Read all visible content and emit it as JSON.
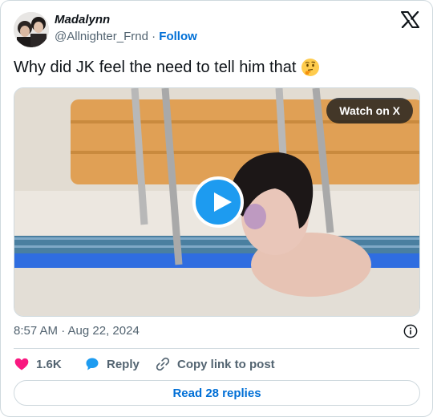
{
  "author": {
    "name": "Madalynn",
    "handle": "@Allnighter_Frnd",
    "separator": "·",
    "follow_label": "Follow"
  },
  "tweet": {
    "text": "Why did JK feel the need to tell him that",
    "emoji": "thinking-face-icon"
  },
  "media": {
    "watch_label": "Watch on X"
  },
  "meta": {
    "timestamp": "8:57 AM · Aug 22, 2024"
  },
  "actions": {
    "likes": "1.6K",
    "reply_label": "Reply",
    "copy_label": "Copy link to post"
  },
  "footer": {
    "read_replies_label": "Read 28 replies"
  },
  "colors": {
    "link_blue": "#006fd6",
    "play_blue": "#1d9bf0",
    "heart_pink": "#f91880",
    "muted": "#536471"
  }
}
